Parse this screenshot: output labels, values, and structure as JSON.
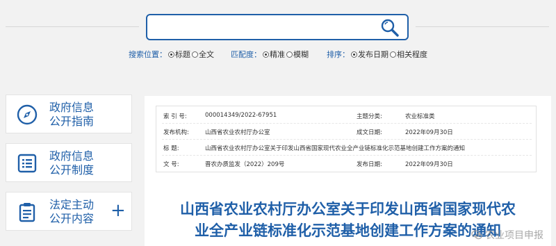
{
  "search": {
    "value": "",
    "placeholder": "",
    "scope_label": "搜索位置：",
    "scope_options": [
      {
        "label": "标题",
        "checked": true
      },
      {
        "label": "全文",
        "checked": false
      }
    ],
    "match_label": "匹配度：",
    "match_options": [
      {
        "label": "精准",
        "checked": true
      },
      {
        "label": "模糊",
        "checked": false
      }
    ],
    "sort_label": "排序：",
    "sort_options": [
      {
        "label": "发布日期",
        "checked": true
      },
      {
        "label": "相关程度",
        "checked": false
      }
    ]
  },
  "sidebar": {
    "items": [
      {
        "line1": "政府信息",
        "line2": "公开指南",
        "icon": "compass-icon"
      },
      {
        "line1": "政府信息",
        "line2": "公开制度",
        "icon": "list-document-icon"
      },
      {
        "line1": "法定主动",
        "line2": "公开内容",
        "icon": "clipboard-icon",
        "expand": "+"
      }
    ]
  },
  "meta": {
    "index_label": "索 引 号:",
    "index_value": "000014349/2022-67951",
    "category_label": "主题分类:",
    "category_value": "农业标准类",
    "publisher_label": "发布机构:",
    "publisher_value": "山西省农业农村厅办公室",
    "created_label": "成文日期:",
    "created_value": "2022年09月30日",
    "title_label": "标      题:",
    "title_value": "山西省农业农村厅办公室关于印发山西省国家现代农业全产业链标准化示范基地创建工作方案的通知",
    "doc_no_label": "文      号:",
    "doc_no_value": "晋农办质监发（2022）209号",
    "published_label": "发布日期:",
    "published_value": "2022年09月30日"
  },
  "article": {
    "title_line1": "山西省农业农村厅办公室关于印发山西省国家现代农",
    "title_line2": "业全产业链标准化示范基地创建工作方案的通知"
  },
  "watermark": {
    "text": "农业项目申报"
  },
  "colors": {
    "accent": "#1f5fa8",
    "background": "#f2f2f2"
  }
}
